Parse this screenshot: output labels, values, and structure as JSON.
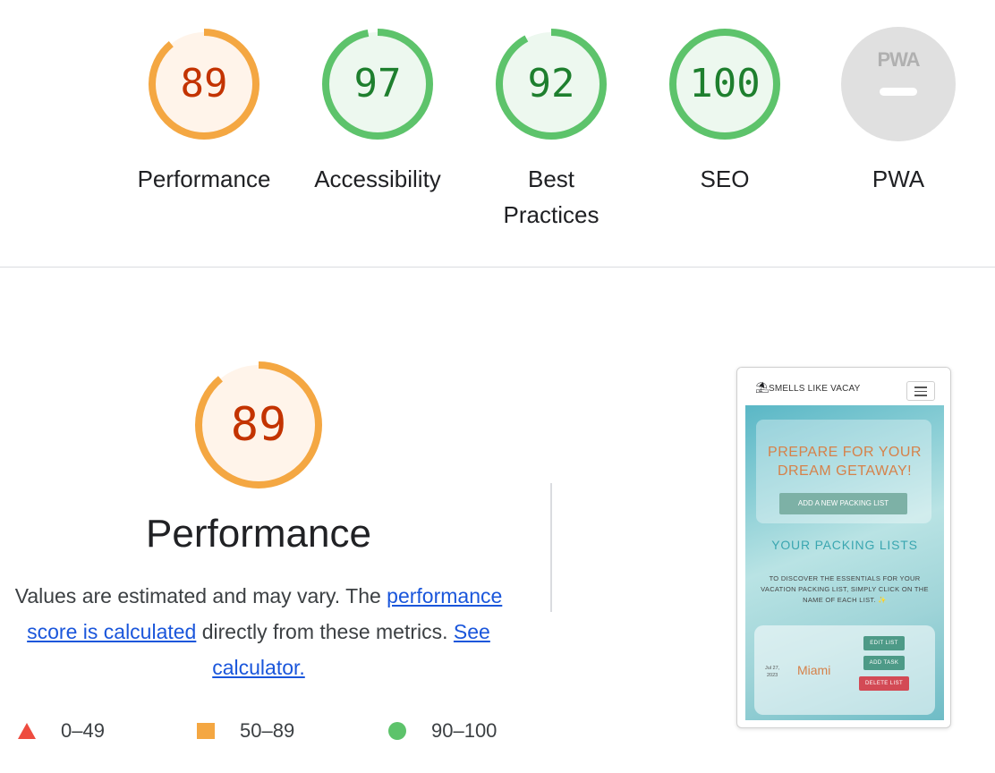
{
  "gauges": [
    {
      "score": "89",
      "label": "Performance",
      "color": "#f4a742",
      "fill": "#fff4ea",
      "text_color": "#c33300",
      "value": 89
    },
    {
      "score": "97",
      "label": "Accessibility",
      "color": "#5dc36b",
      "fill": "#edf8ef",
      "text_color": "#1e7f2e",
      "value": 97
    },
    {
      "score": "92",
      "label": "Best",
      "label2": "Practices",
      "color": "#5dc36b",
      "fill": "#edf8ef",
      "text_color": "#1e7f2e",
      "value": 92
    },
    {
      "score": "100",
      "label": "SEO",
      "color": "#5dc36b",
      "fill": "#edf8ef",
      "text_color": "#1e7f2e",
      "value": 100
    },
    {
      "score": "PWA",
      "label": "PWA",
      "color": "#dcdcdc",
      "fill": "#e0e0e0",
      "text_color": "#b0b0b0",
      "value": 0
    }
  ],
  "performance": {
    "score": "89",
    "value": 89,
    "title": "Performance",
    "desc_1": "Values are estimated and may vary. The ",
    "link_1": "performance score is calculated",
    "desc_2": " directly from these metrics. ",
    "link_2": "See calculator."
  },
  "legend": [
    {
      "range": "0–49",
      "shape": "triangle",
      "color": "#ee4b3f"
    },
    {
      "range": "50–89",
      "shape": "square",
      "color": "#f4a742"
    },
    {
      "range": "90–100",
      "shape": "circle",
      "color": "#5dc36b"
    }
  ],
  "preview": {
    "brand": "SMELLS LIKE VACAY",
    "heading_1": "PREPARE FOR YOUR",
    "heading_2": "DREAM GETAWAY!",
    "add_button": "ADD A NEW PACKING LIST",
    "section_title": "YOUR PACKING LISTS",
    "hint": "TO DISCOVER THE ESSENTIALS FOR YOUR VACATION PACKING LIST, SIMPLY CLICK ON THE NAME OF EACH LIST. ✨",
    "list": {
      "date_1": "Jul 27,",
      "date_2": "2023",
      "name": "Miami",
      "edit": "EDIT LIST",
      "add_task": "ADD TASK",
      "delete": "DELETE LIST"
    }
  }
}
